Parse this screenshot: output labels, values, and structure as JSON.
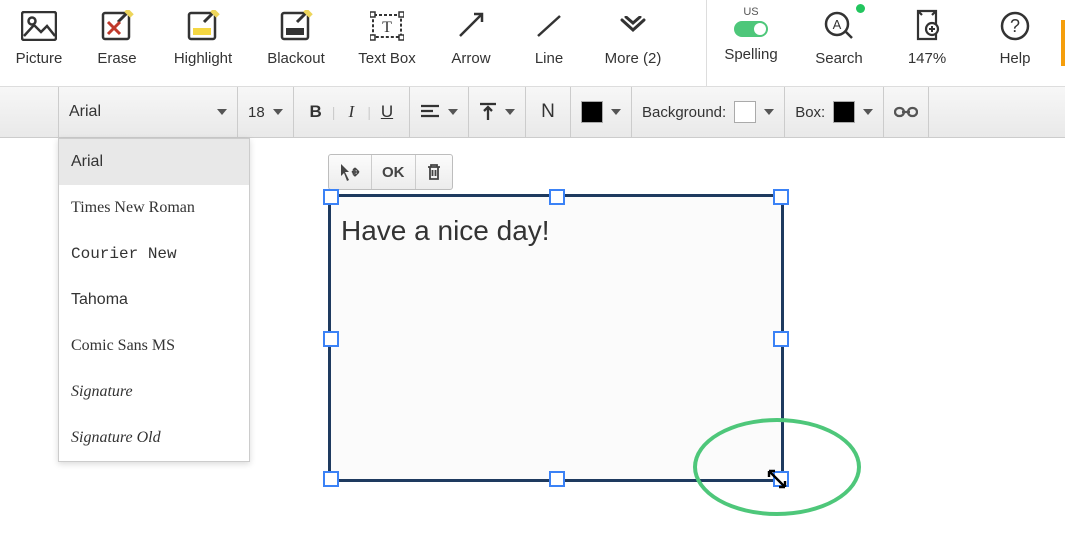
{
  "toolbar": {
    "picture": "Picture",
    "erase": "Erase",
    "highlight": "Highlight",
    "blackout": "Blackout",
    "textbox": "Text Box",
    "arrow": "Arrow",
    "line": "Line",
    "more": "More (2)",
    "spelling_lang": "US",
    "spelling": "Spelling",
    "search": "Search",
    "zoom": "147%",
    "help": "Help"
  },
  "format": {
    "font": "Arial",
    "size": "18",
    "bold": "B",
    "italic": "I",
    "underline": "U",
    "normal": "N",
    "bg_label": "Background:",
    "box_label": "Box:"
  },
  "font_options": [
    "Arial",
    "Times New Roman",
    "Courier New",
    "Tahoma",
    "Comic Sans MS",
    "Signature",
    "Signature Old"
  ],
  "mini": {
    "ok": "OK"
  },
  "textbox_content": "Have a nice day!"
}
